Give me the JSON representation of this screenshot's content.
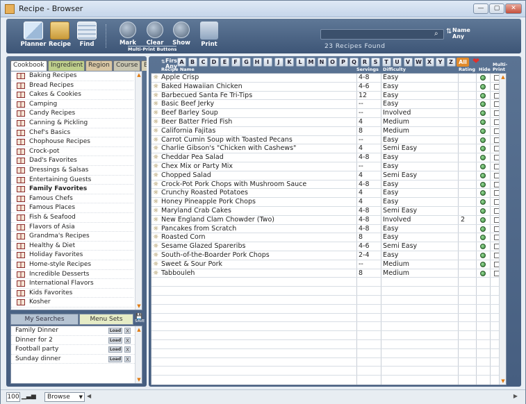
{
  "window": {
    "title": "Recipe - Browser"
  },
  "toolbar": {
    "planner_label": "Planner",
    "recipe_label": "Recipe",
    "find_label": "Find",
    "mark_label": "Mark",
    "clear_label": "Clear",
    "show_label": "Show",
    "print_label": "Print",
    "multi_print_label": "Multi-Print Buttons",
    "recipes_found": "23 Recipes Found",
    "sort_line1": "Name",
    "sort_line2": "Any"
  },
  "left_tabs": [
    "Cookbook",
    "Ingredient",
    "Region",
    "Course",
    "Be"
  ],
  "cookbooks": [
    "Baking Recipes",
    "Bread Recipes",
    "Cakes & Cookies",
    "Camping",
    "Candy Recipes",
    "Canning & Pickling",
    "Chef's Basics",
    "Chophouse Recipes",
    "Crock-pot",
    "Dad's Favorites",
    "Dressings & Salsas",
    "Entertaining Guests",
    "Family Favorites",
    "Famous Chefs",
    "Famous Places",
    "Fish & Seafood",
    "Flavors of Asia",
    "Grandma's Recipes",
    "Healthy & Diet",
    "Holiday Favorites",
    "Home-style Recipes",
    "Incredible Desserts",
    "International Flavors",
    "Kids Favorites",
    "Kosher"
  ],
  "selected_cookbook": "Family Favorites",
  "bottom_tabs": {
    "my_searches": "My Searches",
    "menu_sets": "Menu Sets",
    "save": "SAVE"
  },
  "menu_sets": [
    {
      "name": "Family Dinner",
      "load": "Load",
      "delete": "X"
    },
    {
      "name": "Dinner for 2",
      "load": "Load",
      "delete": "X"
    },
    {
      "name": "Football party",
      "load": "Load",
      "delete": "X"
    },
    {
      "name": "Sunday dinner",
      "load": "Load",
      "delete": "X"
    }
  ],
  "alpha_bar": {
    "first_line1": "First",
    "first_line2": "Any",
    "letters": [
      "A",
      "B",
      "C",
      "D",
      "E",
      "F",
      "G",
      "H",
      "I",
      "J",
      "K",
      "L",
      "M",
      "N",
      "O",
      "P",
      "Q",
      "R",
      "S",
      "T",
      "U",
      "V",
      "W",
      "X",
      "Y",
      "Z"
    ],
    "all": "All"
  },
  "columns": {
    "name": "Recipe Name",
    "servings": "Servings",
    "difficulty": "Difficulty",
    "rating": "Rating",
    "hide": "Hide",
    "multi_print_1": "Multi-",
    "multi_print_2": "Print"
  },
  "recipes": [
    {
      "name": "Apple Crisp",
      "servings": "4-8",
      "difficulty": "Easy",
      "rating": ""
    },
    {
      "name": "Baked Hawaiian Chicken",
      "servings": "4-6",
      "difficulty": "Easy",
      "rating": ""
    },
    {
      "name": "Barbecued Santa Fe Tri-Tips",
      "servings": "12",
      "difficulty": "Easy",
      "rating": ""
    },
    {
      "name": "Basic Beef Jerky",
      "servings": "--",
      "difficulty": "Easy",
      "rating": ""
    },
    {
      "name": "Beef Barley Soup",
      "servings": "--",
      "difficulty": "Involved",
      "rating": ""
    },
    {
      "name": "Beer Batter Fried Fish",
      "servings": "4",
      "difficulty": "Medium",
      "rating": ""
    },
    {
      "name": "California Fajitas",
      "servings": "8",
      "difficulty": "Medium",
      "rating": ""
    },
    {
      "name": "Carrot Cumin Soup with Toasted Pecans",
      "servings": "--",
      "difficulty": "Easy",
      "rating": ""
    },
    {
      "name": "Charlie Gibson's \"Chicken with Cashews\"",
      "servings": "4",
      "difficulty": "Semi Easy",
      "rating": ""
    },
    {
      "name": "Cheddar Pea Salad",
      "servings": "4-8",
      "difficulty": "Easy",
      "rating": ""
    },
    {
      "name": "Chex Mix or Party Mix",
      "servings": "--",
      "difficulty": "Easy",
      "rating": ""
    },
    {
      "name": "Chopped Salad",
      "servings": "4",
      "difficulty": "Semi Easy",
      "rating": ""
    },
    {
      "name": "Crock-Pot Pork Chops with Mushroom Sauce",
      "servings": "4-8",
      "difficulty": "Easy",
      "rating": ""
    },
    {
      "name": "Crunchy Roasted Potatoes",
      "servings": "4",
      "difficulty": "Easy",
      "rating": ""
    },
    {
      "name": "Honey Pineapple Pork Chops",
      "servings": "4",
      "difficulty": "Easy",
      "rating": ""
    },
    {
      "name": "Maryland Crab Cakes",
      "servings": "4-8",
      "difficulty": "Semi Easy",
      "rating": ""
    },
    {
      "name": "New England Clam Chowder (Two)",
      "servings": "4-8",
      "difficulty": "Involved",
      "rating": "2"
    },
    {
      "name": "Pancakes from Scratch",
      "servings": "4-8",
      "difficulty": "Easy",
      "rating": ""
    },
    {
      "name": "Roasted Corn",
      "servings": "8",
      "difficulty": "Easy",
      "rating": ""
    },
    {
      "name": "Sesame Glazed Spareribs",
      "servings": "4-6",
      "difficulty": "Semi Easy",
      "rating": ""
    },
    {
      "name": "South-of-the-Boarder Pork Chops",
      "servings": "2-4",
      "difficulty": "Easy",
      "rating": ""
    },
    {
      "name": "Sweet & Sour Pork",
      "servings": "--",
      "difficulty": "Medium",
      "rating": ""
    },
    {
      "name": "Tabbouleh",
      "servings": "8",
      "difficulty": "Medium",
      "rating": ""
    }
  ],
  "statusbar": {
    "zoom": "100",
    "mode": "Browse"
  },
  "colors": {
    "accent": "#e08a2b",
    "toolbar": "#4a6384",
    "selected_tab": "#ffffff"
  }
}
